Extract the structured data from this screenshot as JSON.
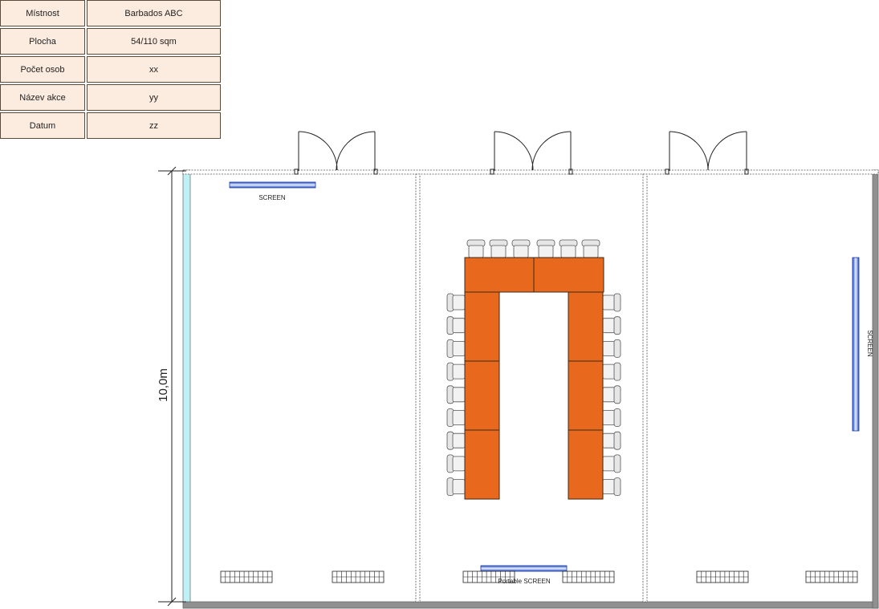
{
  "info_table": [
    {
      "label": "Místnost",
      "value": "Barbados ABC"
    },
    {
      "label": "Plocha",
      "value": "54/110 sqm"
    },
    {
      "label": "Počet osob",
      "value": "xx"
    },
    {
      "label": "Název akce",
      "value": "yy"
    },
    {
      "label": "Datum",
      "value": "zz"
    }
  ],
  "plan": {
    "dimension_label": "10,0m",
    "screen_labels": {
      "room_a": "SCREEN",
      "room_c": "SCREEN",
      "portable": "Portable SCREEN"
    },
    "colors": {
      "table": "#e8691e",
      "chair": "#e6e6e6",
      "screen": "#3a63d8",
      "wall": "#808080",
      "window_wall": "#bff0f5",
      "info_cell": "#fcece0"
    }
  }
}
